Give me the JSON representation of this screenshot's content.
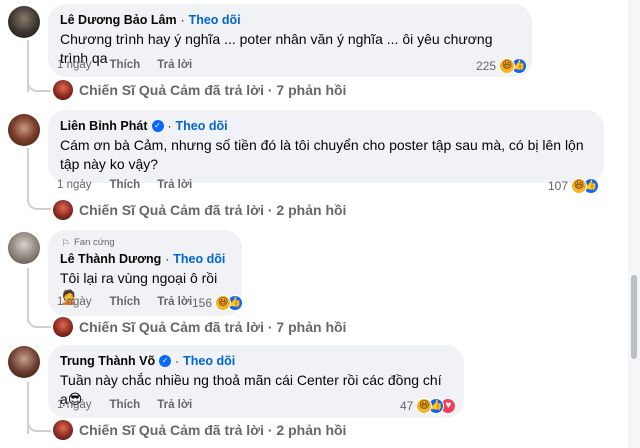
{
  "comments": [
    {
      "name": "Lê Dương Bảo Lâm",
      "verified": false,
      "badge": "",
      "follow": "Theo dõi",
      "text": "Chương trình hay ý nghĩa ... poter nhân văn ý nghĩa ... ôi yêu chương trình qa",
      "time": "1 ngày",
      "like": "Thích",
      "reply": "Trả lời",
      "reaction_count": "225",
      "reactions": [
        "haha-icon",
        "like-icon"
      ],
      "replies": "Chiến Sĩ Quả Cảm đã trả lời · 7 phản hồi"
    },
    {
      "name": "Liên Bỉnh Phát",
      "verified": true,
      "badge": "",
      "follow": "Theo dõi",
      "text": "Cám ơn bà Cảm, nhưng số tiền đó là tôi chuyển cho poster tập sau mà, có bị lên lộn tập này ko vậy?",
      "time": "1 ngày",
      "like": "Thích",
      "reply": "Trả lời",
      "reaction_count": "107",
      "reactions": [
        "haha-icon",
        "like-icon"
      ],
      "replies": "Chiến Sĩ Quả Cảm đã trả lời · 2 phản hồi"
    },
    {
      "name": "Lê Thành Dương",
      "verified": false,
      "badge": "Fan cứng",
      "follow": "Theo dõi",
      "text": "Tôi lại ra vùng ngoại ô rồi 🤦",
      "time": "1 ngày",
      "like": "Thích",
      "reply": "Trả lời",
      "reaction_count": "156",
      "reactions": [
        "haha-icon",
        "like-icon"
      ],
      "replies": "Chiến Sĩ Quả Cảm đã trả lời · 7 phản hồi"
    },
    {
      "name": "Trung Thành Võ",
      "verified": true,
      "badge": "",
      "follow": "Theo dõi",
      "text": "Tuần này chắc nhiều ng thoả mãn cái Center rồi các đồng chí ạ😎",
      "time": "1 ngày",
      "like": "Thích",
      "reply": "Trả lời",
      "reaction_count": "47",
      "reactions": [
        "haha-icon",
        "like-icon",
        "love-icon"
      ],
      "replies": "Chiến Sĩ Quả Cảm đã trả lời · 2 phản hồi"
    }
  ],
  "colors": {
    "bubble": "#f0f2f5",
    "follow": "#0064d1",
    "secondary_text": "#65676b",
    "like_blue": "#0866ff",
    "haha_yellow": "#f7b125",
    "love_red": "#f33e58"
  }
}
